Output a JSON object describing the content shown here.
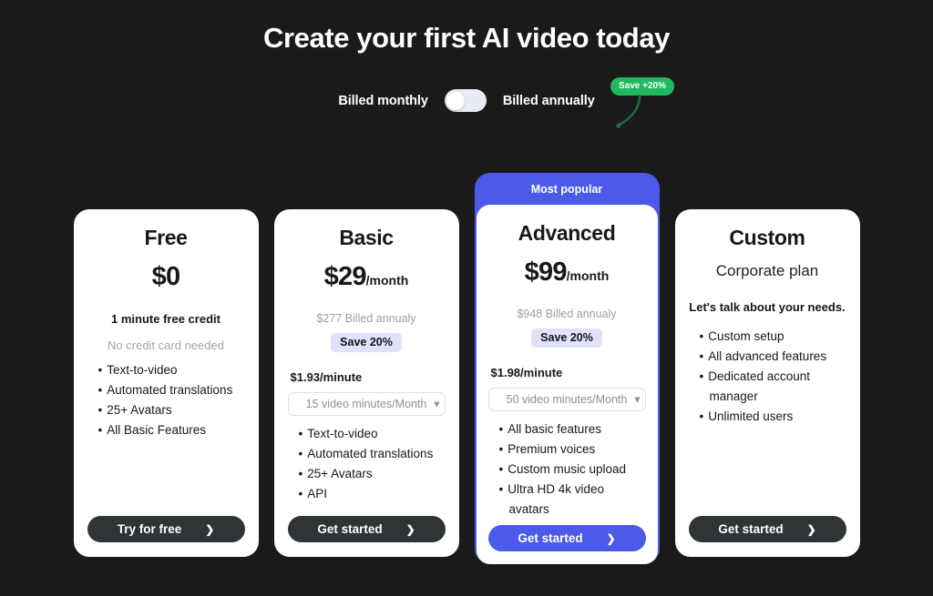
{
  "header": {
    "title": "Create your first AI video today"
  },
  "billing": {
    "monthly_label": "Billed monthly",
    "annual_label": "Billed annually",
    "toggle_state": "monthly",
    "save_badge": "Save +20%",
    "badge_color": "#22b860"
  },
  "theme": {
    "background": "#1a1a1a",
    "accent": "#4b5ae8",
    "dark_button": "#2f3437",
    "chip_background": "#dfe2f8"
  },
  "plans": [
    {
      "name": "Free",
      "price_amount": "$0",
      "price_period": "",
      "price_sub": "",
      "billed_note": "",
      "save_chip": "",
      "tagline": "1 minute free credit",
      "subtagline": "No credit card needed",
      "per_minute": "",
      "minutes_select": "",
      "features": [
        "Text-to-video",
        "Automated translations",
        "25+ Avatars",
        "All Basic Features"
      ],
      "cta_label": "Try for free",
      "featured": false,
      "banner": ""
    },
    {
      "name": "Basic",
      "price_amount": "$29",
      "price_period": "/month",
      "price_sub": "",
      "billed_note": "$277 Billed annualy",
      "save_chip": "Save 20%",
      "tagline": "",
      "subtagline": "",
      "per_minute": "$1.93/minute",
      "minutes_select": "15 video minutes/Month",
      "features": [
        "Text-to-video",
        "Automated translations",
        "25+ Avatars",
        "API"
      ],
      "cta_label": "Get started",
      "featured": false,
      "banner": ""
    },
    {
      "name": "Advanced",
      "price_amount": "$99",
      "price_period": "/month",
      "price_sub": "",
      "billed_note": "$948 Billed annualy",
      "save_chip": "Save 20%",
      "tagline": "",
      "subtagline": "",
      "per_minute": "$1.98/minute",
      "minutes_select": "50 video minutes/Month",
      "features": [
        "All basic features",
        "Premium voices",
        "Custom music upload",
        "Ultra HD 4k video avatars"
      ],
      "cta_label": "Get started",
      "featured": true,
      "banner": "Most popular"
    },
    {
      "name": "Custom",
      "price_amount": "",
      "price_period": "",
      "price_sub": "Corporate plan",
      "billed_note": "",
      "save_chip": "",
      "tagline": "Let's talk about your needs.",
      "subtagline": "",
      "per_minute": "",
      "minutes_select": "",
      "features": [
        "Custom setup",
        "All advanced features",
        "Dedicated account manager",
        "Unlimited users"
      ],
      "cta_label": "Get started",
      "featured": false,
      "banner": ""
    }
  ]
}
